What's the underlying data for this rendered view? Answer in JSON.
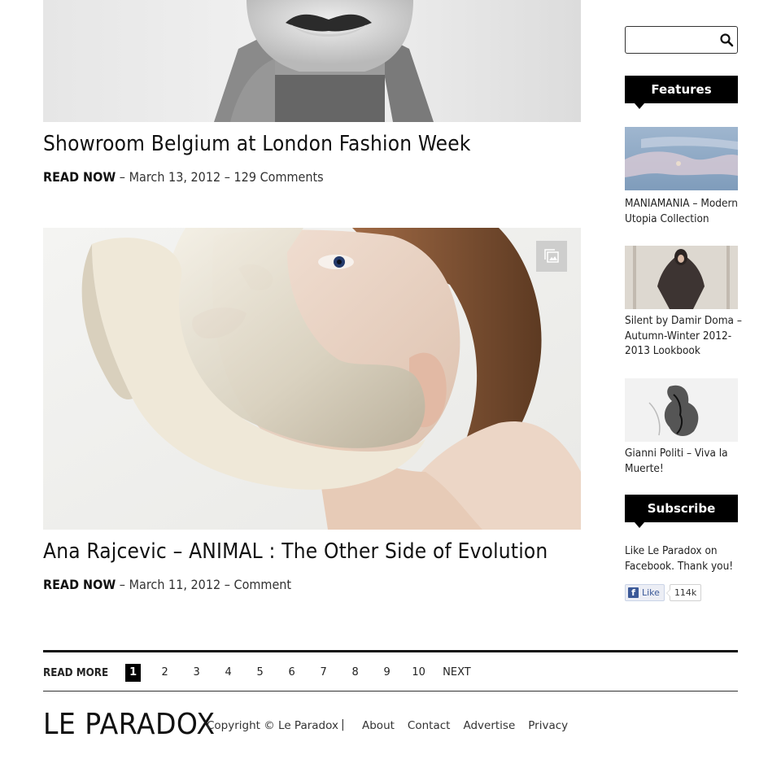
{
  "posts": [
    {
      "title": "Showroom Belgium at London Fashion Week",
      "read_label": "READ NOW",
      "meta": " – March 13, 2012 – 129 Comments"
    },
    {
      "title": "Ana Rajcevic – ANIMAL : The Other Side of Evolution",
      "read_label": "READ NOW",
      "meta": " – March 11, 2012 – Comment"
    }
  ],
  "sidebar": {
    "search": {
      "placeholder": ""
    },
    "features_heading": "Features",
    "features": [
      {
        "caption": "MANIAMANIA – Modern Utopia Collection"
      },
      {
        "caption": "Silent by Damir Doma – Autumn-Winter 2012-2013 Lookbook"
      },
      {
        "caption": "Gianni Politi – Viva la Muerte!"
      }
    ],
    "subscribe_heading": "Subscribe",
    "subscribe_text": "Like Le Paradox on Facebook. Thank you!",
    "fb": {
      "like_label": "Like",
      "count": "114k"
    }
  },
  "pagination": {
    "label": "READ MORE",
    "pages": [
      "1",
      "2",
      "3",
      "4",
      "5",
      "6",
      "7",
      "8",
      "9",
      "10"
    ],
    "current": "1",
    "next_label": "NEXT"
  },
  "footer": {
    "logo": "LE PARADOX",
    "copyright": "Copyright © Le Paradox",
    "separator": "|",
    "links": [
      "About",
      "Contact",
      "Advertise",
      "Privacy"
    ]
  },
  "icons": {
    "search": "magnifier",
    "gallery": "gallery-stack"
  }
}
